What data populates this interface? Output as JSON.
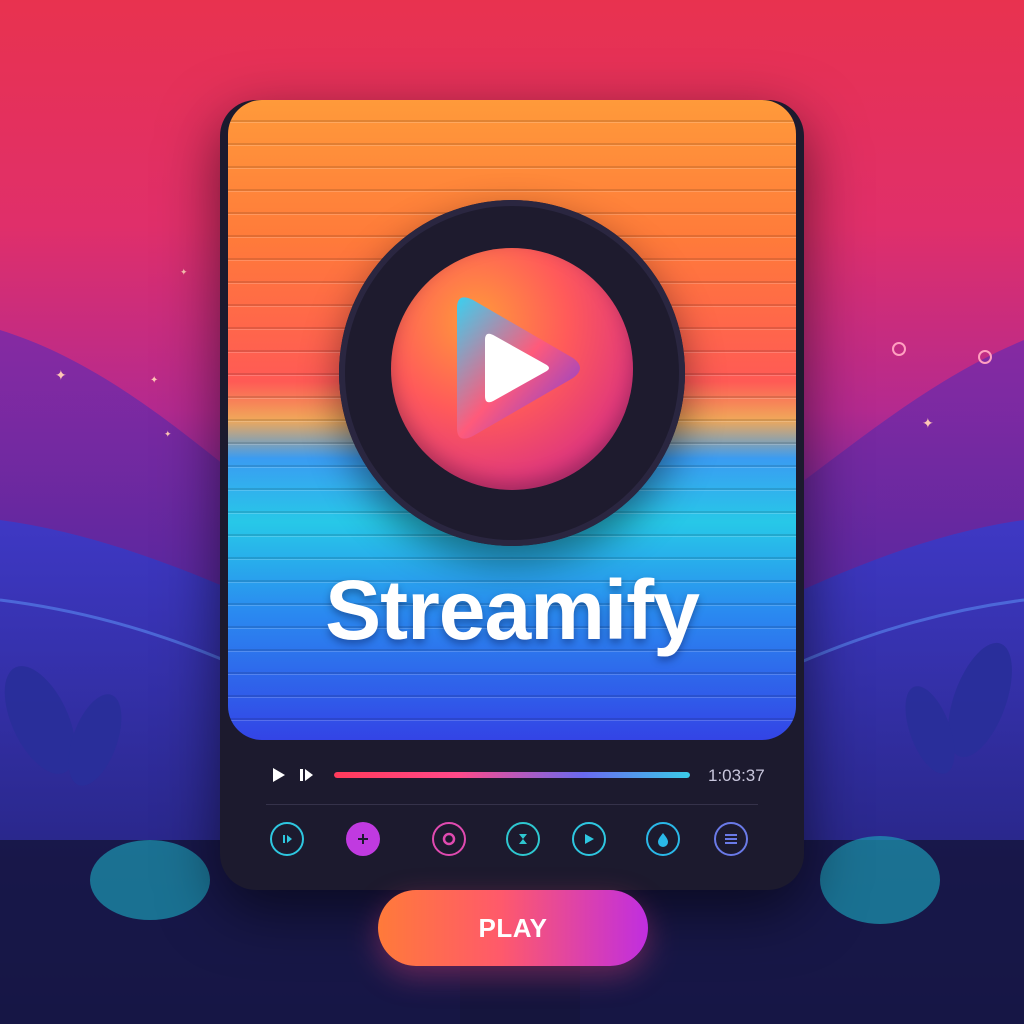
{
  "app": {
    "brand_name": "Streamify"
  },
  "player": {
    "elapsed_time": "1:03:37",
    "progress": 1.0
  },
  "icons": [
    {
      "name": "pause-circle-icon",
      "color": "#2ec7e0"
    },
    {
      "name": "plus-icon",
      "color": "#c03ae0"
    },
    {
      "name": "record-icon",
      "color": "#e04ab0"
    },
    {
      "name": "hourglass-icon",
      "color": "#2ec7d0"
    },
    {
      "name": "forward-icon",
      "color": "#2ec7e0"
    },
    {
      "name": "drop-icon",
      "color": "#2ab8e8"
    },
    {
      "name": "list-icon",
      "color": "#6a7ae8"
    }
  ],
  "actions": {
    "play_label": "PLAY"
  },
  "colors": {
    "accent": "#ff5a6a",
    "accent_secondary": "#2ec7e0",
    "card_bg": "#1c1a2e"
  }
}
